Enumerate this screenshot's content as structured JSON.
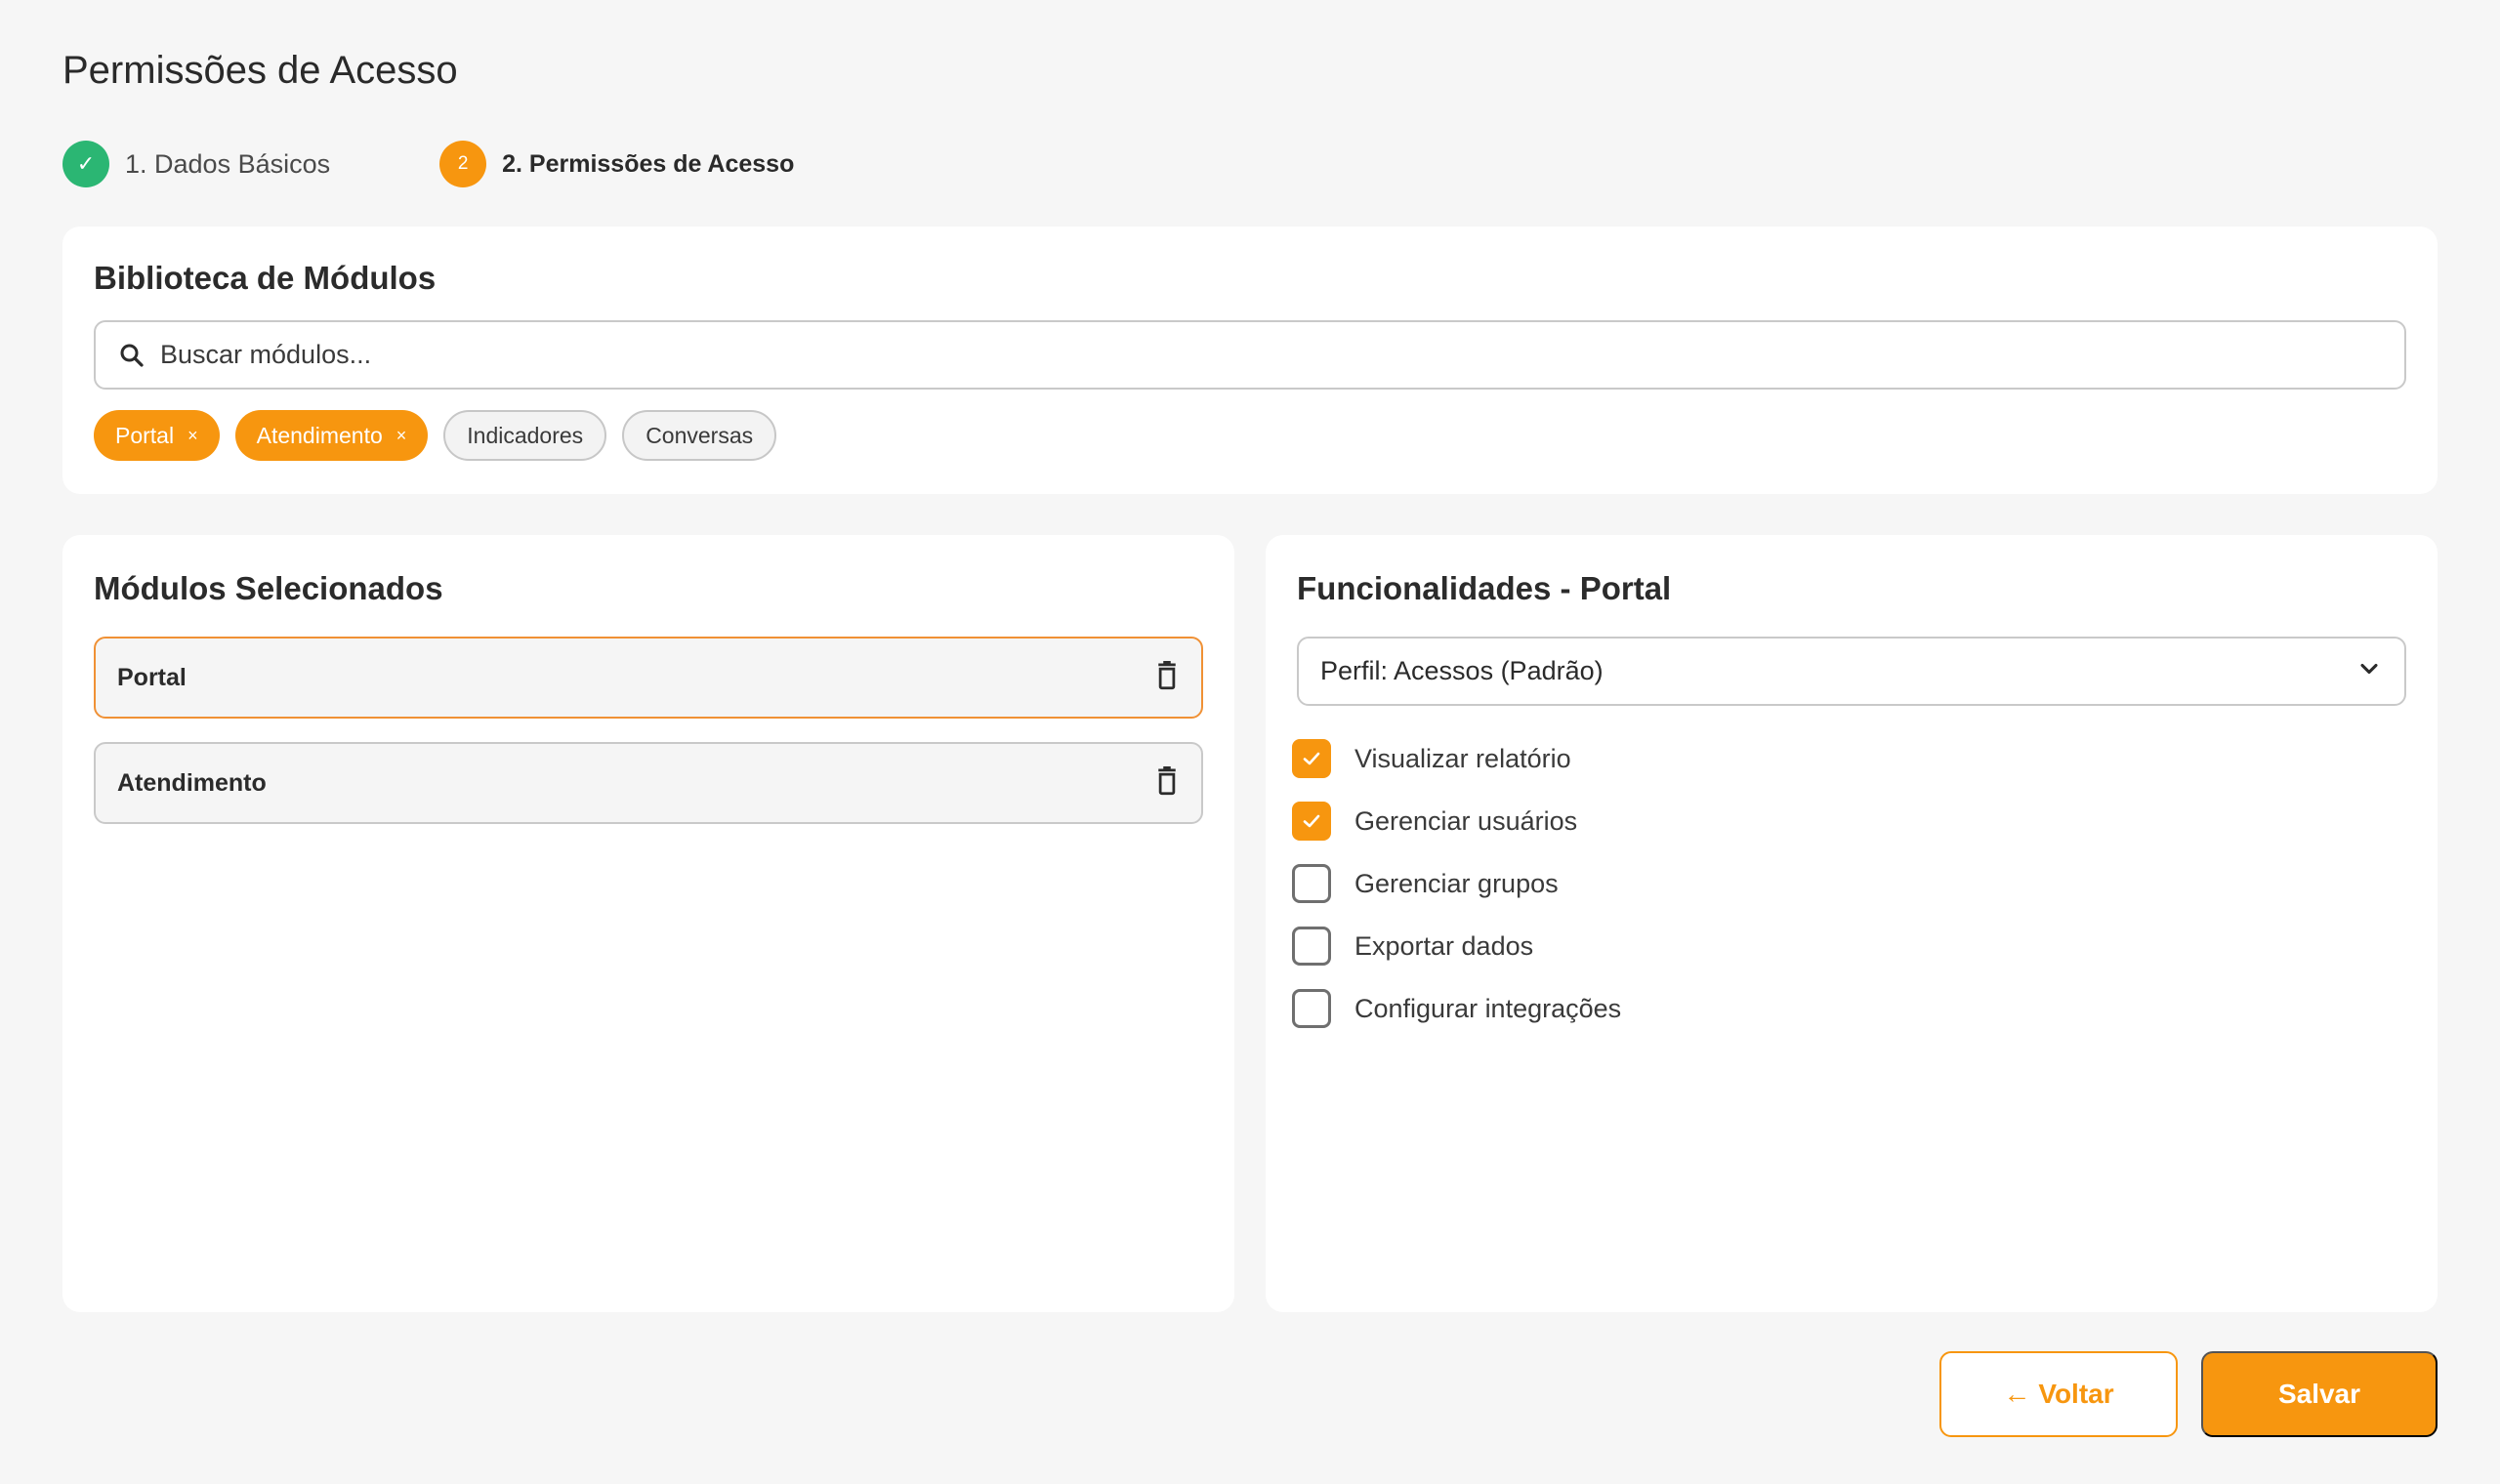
{
  "page": {
    "title": "Permissões de Acesso"
  },
  "stepper": {
    "steps": [
      {
        "number": "✓",
        "label": "1. Dados Básicos",
        "state": "done"
      },
      {
        "number": "2",
        "label": "2. Permissões de Acesso",
        "state": "active"
      }
    ]
  },
  "library": {
    "title": "Biblioteca de Módulos",
    "search_placeholder": "Buscar módulos...",
    "chips": [
      {
        "label": "Portal",
        "selected": true,
        "remove": "×"
      },
      {
        "label": "Atendimento",
        "selected": true,
        "remove": "×"
      },
      {
        "label": "Indicadores",
        "selected": false
      },
      {
        "label": "Conversas",
        "selected": false
      }
    ]
  },
  "selected_modules": {
    "title": "Módulos Selecionados",
    "items": [
      {
        "label": "Portal",
        "active": true
      },
      {
        "label": "Atendimento",
        "active": false
      }
    ]
  },
  "features": {
    "title": "Funcionalidades - Portal",
    "profile_select": "Perfil: Acessos (Padrão)",
    "items": [
      {
        "label": "Visualizar relatório",
        "checked": true
      },
      {
        "label": "Gerenciar usuários",
        "checked": true
      },
      {
        "label": "Gerenciar grupos",
        "checked": false
      },
      {
        "label": "Exportar dados",
        "checked": false
      },
      {
        "label": "Configurar integrações",
        "checked": false
      }
    ]
  },
  "footer": {
    "back_label": "Voltar",
    "back_arrow": "←",
    "save_label": "Salvar"
  },
  "colors": {
    "accent": "#f7960f",
    "success": "#2bb673"
  }
}
